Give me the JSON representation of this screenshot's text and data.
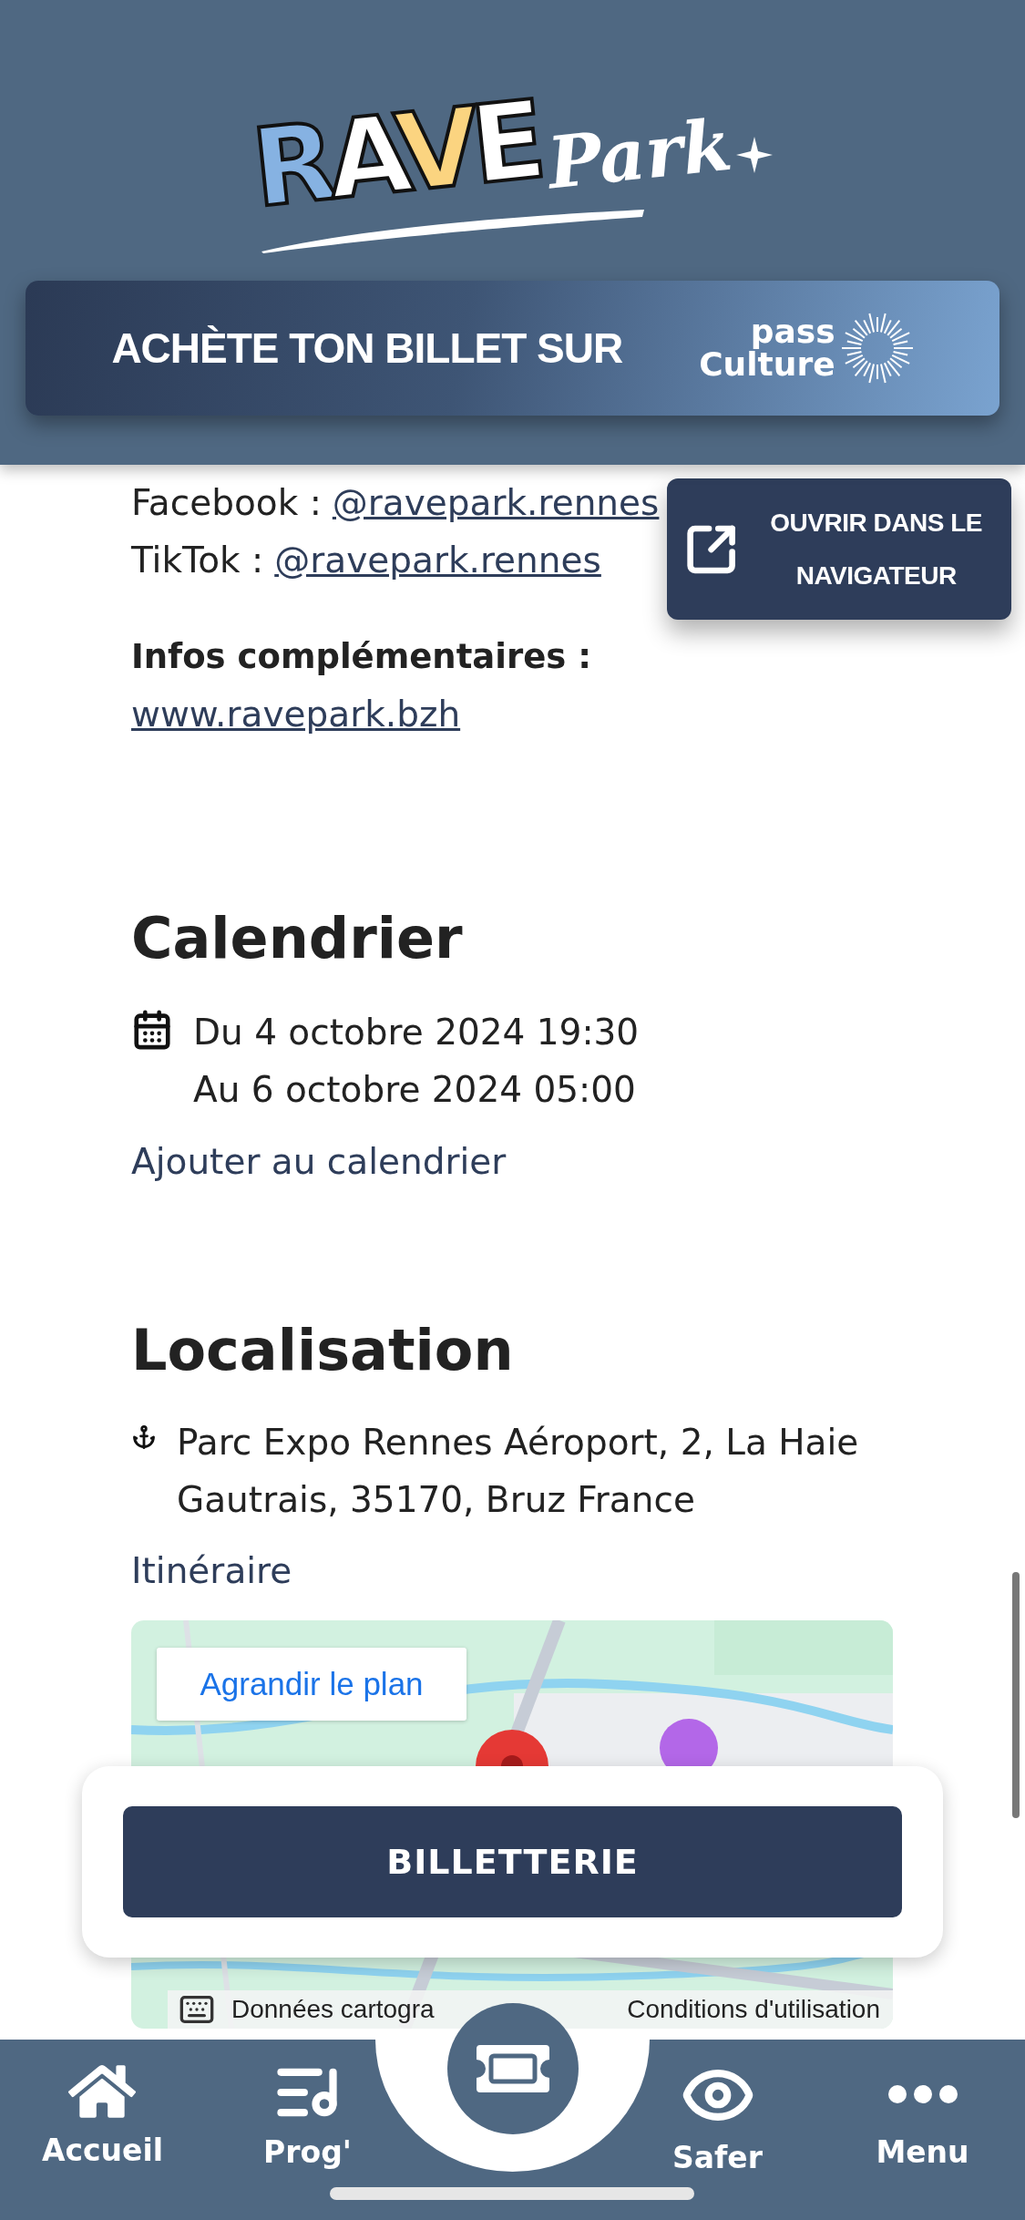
{
  "header": {
    "logo": {
      "main": "RAVE",
      "script": "Park"
    },
    "banner": {
      "text": "ACHÈTE TON BILLET SUR",
      "partner_line1": "pass",
      "partner_line2": "Culture"
    }
  },
  "social": [
    {
      "label": "Facebook :",
      "handle": "@ravepark.rennes"
    },
    {
      "label": "TikTok :",
      "handle": "@ravepark.rennes"
    }
  ],
  "open_browser_button": "OUVRIR DANS LE NAVIGATEUR",
  "infos": {
    "heading": "Infos complémentaires :",
    "link": "www.ravepark.bzh"
  },
  "calendar": {
    "heading": "Calendrier",
    "start": "Du 4 octobre 2024 19:30",
    "end": "Au 6 octobre 2024 05:00",
    "add_link": "Ajouter au calendrier"
  },
  "location": {
    "heading": "Localisation",
    "address": "Parc Expo Rennes Aéroport, 2, La Haie Gautrais, 35170, Bruz France",
    "route_link": "Itinéraire",
    "map": {
      "kind": "picture",
      "enlarge_button": "Agrandir le plan",
      "attribution": "Données cartogra",
      "terms": "Conditions d'utilisation"
    }
  },
  "ticket_button": "BILLETTERIE",
  "nav": [
    {
      "kind": "home",
      "label": "Accueil"
    },
    {
      "kind": "program",
      "label": "Prog'"
    },
    {
      "kind": "ticket"
    },
    {
      "kind": "safer",
      "label": "Safer"
    },
    {
      "kind": "menu",
      "label": "Menu"
    }
  ]
}
